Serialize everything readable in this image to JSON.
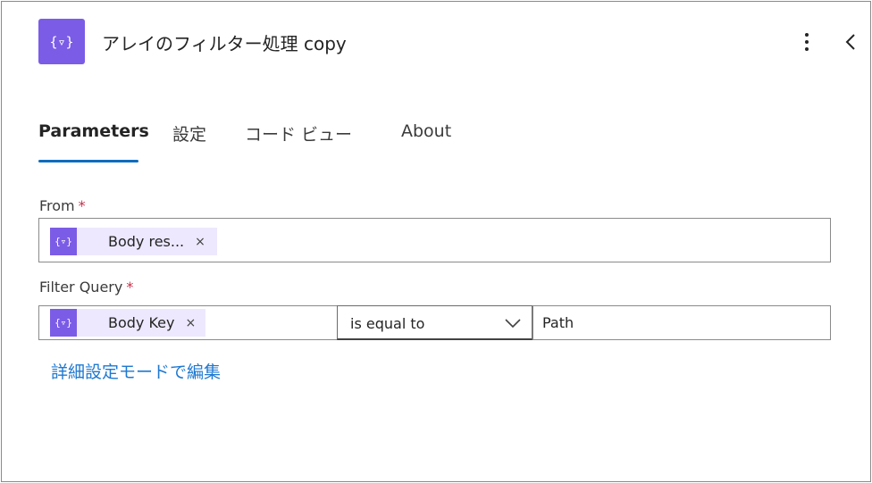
{
  "header": {
    "icon_glyph": "{▿}",
    "icon_name": "filter-array-icon",
    "title": "アレイのフィルター処理 copy",
    "more_icon": "more-vertical-icon",
    "collapse_icon": "chevron-left-icon"
  },
  "tabs": [
    {
      "label": "Parameters",
      "active": true
    },
    {
      "label": "設定",
      "active": false
    },
    {
      "label": "コード ビュー",
      "active": false
    },
    {
      "label": "About",
      "active": false
    }
  ],
  "form": {
    "from": {
      "label": "From",
      "required_mark": "*",
      "token": {
        "icon_glyph": "{▿}",
        "label": "Body res...",
        "close": "×"
      }
    },
    "filter_query": {
      "label": "Filter Query",
      "required_mark": "*",
      "left_token": {
        "icon_glyph": "{▿}",
        "label": "Body Key",
        "close": "×"
      },
      "operator": "is equal to",
      "right_value": "Path"
    }
  },
  "advanced_link": "詳細設定モードで編集",
  "colors": {
    "accent": "#0f6cbd",
    "icon_bg": "#7b5ce6",
    "token_bg": "#ede8fd",
    "link": "#1e78d0",
    "required": "#c4314b"
  }
}
